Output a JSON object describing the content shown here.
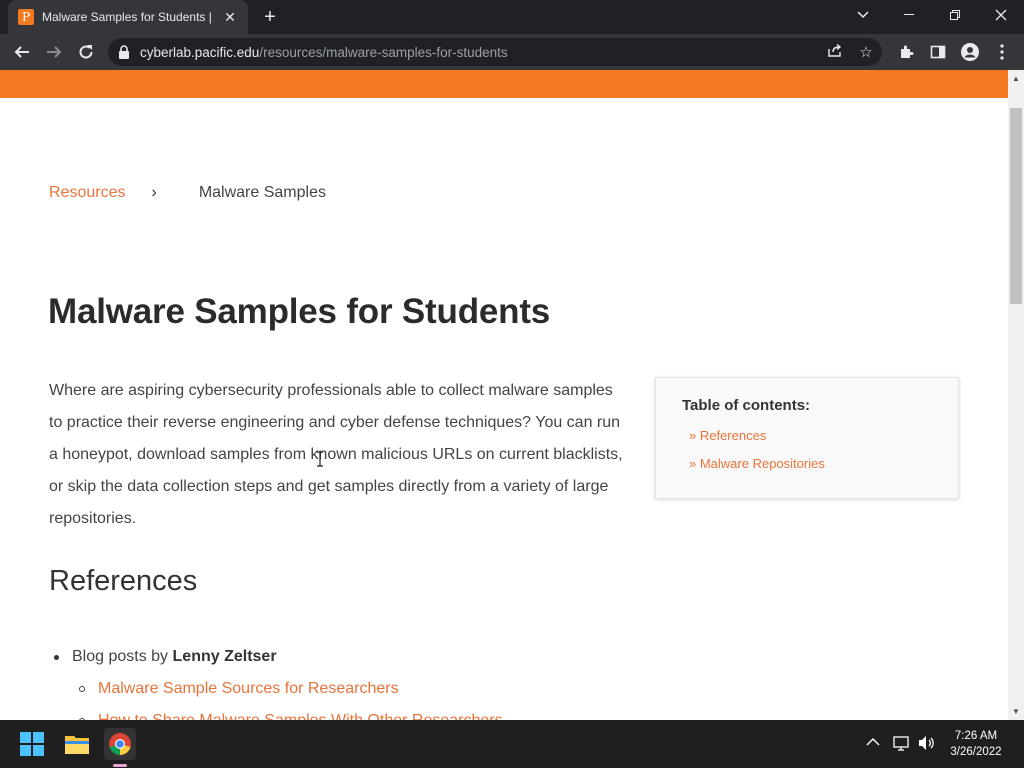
{
  "browser": {
    "tab_title": "Malware Samples for Students | P",
    "favicon_letter": "P",
    "url_host": "cyberlab.pacific.edu",
    "url_path": "/resources/malware-samples-for-students"
  },
  "page": {
    "breadcrumb": {
      "parent": "Resources",
      "separator": "›",
      "current": "Malware Samples"
    },
    "title": "Malware Samples for Students",
    "intro": "Where are aspiring cybersecurity professionals able to collect malware samples to practice their reverse engineering and cyber defense techniques? You can run a honeypot, download samples from known malicious URLs on current blacklists, or skip the data collection steps and get samples directly from a variety of large repositories.",
    "toc": {
      "title": "Table of contents:",
      "items": [
        "» References",
        "» Malware Repositories"
      ]
    },
    "references_heading": "References",
    "references": {
      "blog_prefix": "Blog posts by ",
      "blog_author": "Lenny Zeltser",
      "links": [
        "Malware Sample Sources for Researchers",
        "How to Share Malware Samples With Other Researchers"
      ]
    }
  },
  "taskbar": {
    "time": "7:26 AM",
    "date": "3/26/2022"
  },
  "colors": {
    "accent": "#f47920",
    "link": "#e8743b"
  }
}
